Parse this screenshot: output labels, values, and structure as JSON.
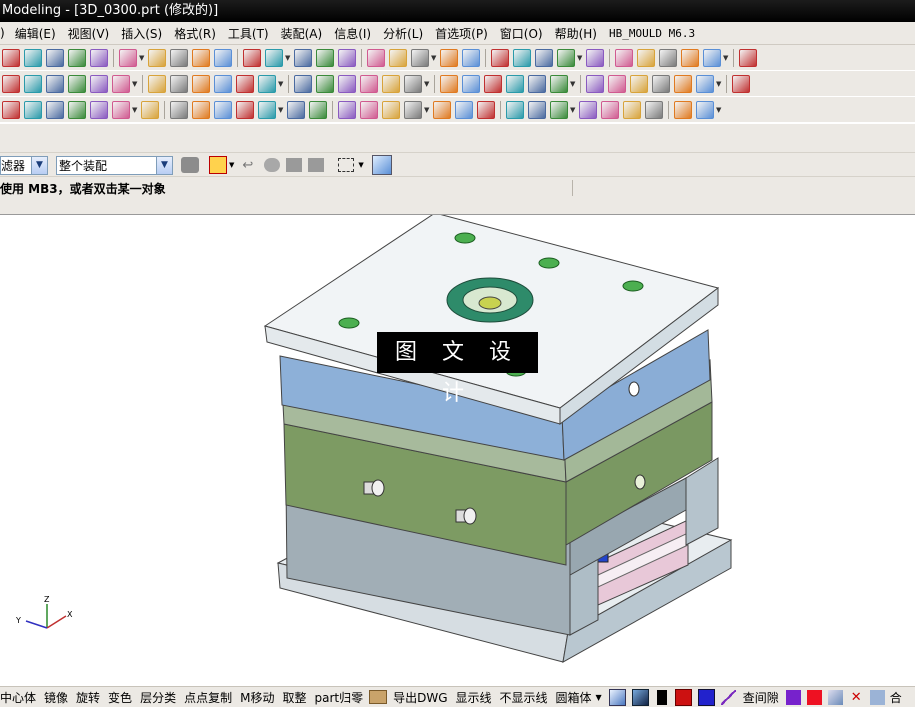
{
  "window": {
    "title": "Modeling - [3D_0300.prt (修改的)]"
  },
  "menu": {
    "items": [
      "编辑(E)",
      "视图(V)",
      "插入(S)",
      "格式(R)",
      "工具(T)",
      "装配(A)",
      "信息(I)",
      "分析(L)",
      "首选项(P)",
      "窗口(O)",
      "帮助(H)",
      "HB_MOULD M6.3"
    ],
    "lead": ")"
  },
  "toolbar_row1": {
    "icons": [
      "new-icon",
      "open-icon",
      "save-icon",
      "cut-icon",
      "copy-icon",
      "paste-icon",
      "delete-icon",
      "undo-icon",
      "redo-icon",
      "wrench-icon",
      "fit-icon",
      "zoom-window-icon",
      "zoom-icon",
      "rotate-icon",
      "pan-icon",
      "orient-icon",
      "shaded-cube-icon",
      "render-icon",
      "lights-icon",
      "frame-icon",
      "sketch-icon",
      "pull-icon",
      "move-face-icon",
      "edge-blend-icon",
      "chamfer-icon",
      "wcs-icon",
      "point-icon",
      "csys-icon",
      "move-icon",
      "scale-icon",
      "axis-icon"
    ]
  },
  "toolbar_row2": {
    "icons": [
      "blend-icon",
      "variable-blend-icon",
      "thicken-icon",
      "sphere-icon",
      "extrude-icon",
      "revolve-icon",
      "sweep-icon",
      "draft-icon",
      "hole-icon",
      "boss-icon",
      "pocket-icon",
      "pad-icon",
      "slot-icon",
      "groove-icon",
      "block-icon",
      "cylinder-icon",
      "cone-icon",
      "tube-icon",
      "sew-icon",
      "patch-icon",
      "trim-icon",
      "split-icon",
      "shell-icon",
      "offset-icon",
      "mirror-icon",
      "pattern-icon",
      "line-icon",
      "arc-icon",
      "curve-icon",
      "spline-icon",
      "fillet-curve-icon"
    ]
  },
  "toolbar_row3": {
    "icons": [
      "layer-icon",
      "grid-icon",
      "color-icon",
      "table-icon",
      "slash-icon",
      "circle-icon",
      "hatch-icon",
      "box-icon",
      "stack-icon",
      "measure-icon",
      "angle-icon",
      "erase-icon",
      "delete-red-icon",
      "list-icon",
      "frame2-icon",
      "assembly-icon",
      "component-icon",
      "add-component-icon",
      "mate-icon",
      "reposition-icon",
      "explode-icon",
      "sequence-icon",
      "clearance-icon",
      "wave-icon",
      "link-icon",
      "arrangement-icon",
      "mould-icon",
      "cavity-icon",
      "line-red-icon",
      "pencil-icon"
    ]
  },
  "filter": {
    "type_label": "滤器",
    "scope_value": "整个装配"
  },
  "cue": {
    "text": "使用 MB3，或者双击某一对象"
  },
  "view": {
    "triad_x": "X",
    "triad_y": "Y",
    "triad_z": "Z"
  },
  "watermark": {
    "text": "图 文 设 计"
  },
  "bottom": {
    "items": [
      "中心体",
      "镜像",
      "旋转",
      "变色",
      "层分类",
      "点点复制",
      "M移动",
      "取整",
      "part归零",
      "导出DWG",
      "显示线",
      "不显示线",
      "圆箱体"
    ],
    "query_label": "查间隙",
    "last_label": "合"
  },
  "colors": {
    "plate_top": "#f1f4f6",
    "plate_blue": "#8fb0d6",
    "plate_sage": "#a9bb9d",
    "plate_green": "#7f9d62",
    "plate_gray": "#a3b0b8",
    "ring_green": "#2e8b6a",
    "bolt_green": "#4caf50"
  }
}
